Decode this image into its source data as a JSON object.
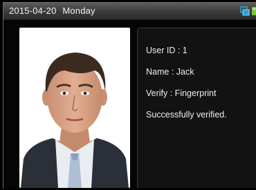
{
  "status_bar": {
    "date": "2015-04-20",
    "weekday": "Monday",
    "icons": [
      "network-icon",
      "signal-icon"
    ]
  },
  "verification": {
    "user_id_label": "User ID : 1",
    "name_label": "Name : Jack",
    "verify_label": "Verify : Fingerprint",
    "message": "Successfully verified."
  },
  "colors": {
    "status_bar": "#4a4a4a",
    "icon_blue": "#2e9ed8",
    "icon_green": "#7fc241"
  }
}
